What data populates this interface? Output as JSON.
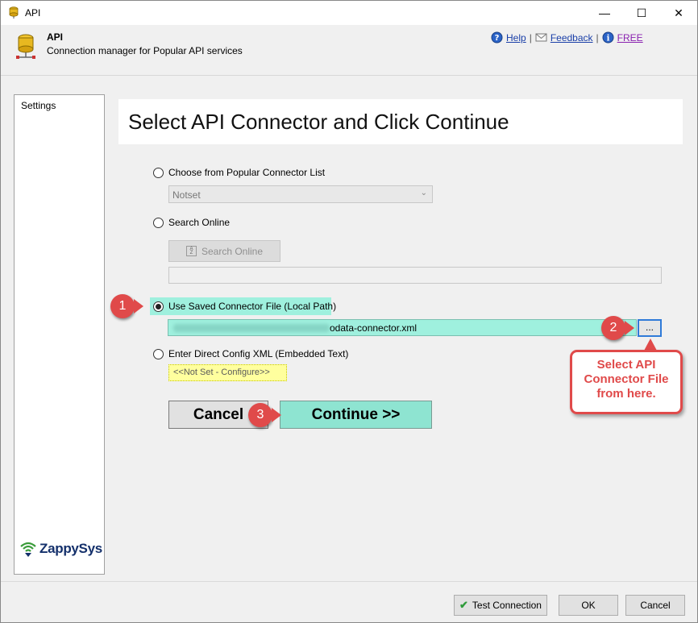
{
  "window": {
    "title": "API",
    "minimize_glyph": "—",
    "maximize_glyph": "☐",
    "close_glyph": "✕"
  },
  "header": {
    "title": "API",
    "subtitle": "Connection manager for Popular API services",
    "links": {
      "help": "Help",
      "feedback": "Feedback",
      "free": "FREE"
    }
  },
  "sidebar": {
    "items": [
      {
        "label": "Settings"
      }
    ],
    "logo_text": "ZappySys"
  },
  "main": {
    "title": "Select API Connector and Click Continue",
    "options": {
      "popular": {
        "label": "Choose from Popular Connector List",
        "selected": false,
        "combo_value": "Notset"
      },
      "online": {
        "label": "Search Online",
        "selected": false,
        "button_label": "Search Online",
        "search_value": ""
      },
      "saved": {
        "label": "Use Saved Connector File (Local Path)",
        "selected": true,
        "file_value": "odata-connector.xml",
        "browse_label": "..."
      },
      "direct": {
        "label": "Enter Direct Config XML (Embedded Text)",
        "selected": false,
        "config_value": "<<Not Set - Configure>>"
      }
    },
    "cancel_label": "Cancel",
    "continue_label": "Continue >>"
  },
  "annotations": {
    "badge1": "1",
    "badge2": "2",
    "badge3": "3",
    "callout_lines": [
      "Select API",
      "Connector File",
      "from here."
    ],
    "color": "#e04a4a",
    "highlight_color": "#9ff0de"
  },
  "footer": {
    "test_connection_label": "Test Connection",
    "ok_label": "OK",
    "cancel_label": "Cancel"
  }
}
